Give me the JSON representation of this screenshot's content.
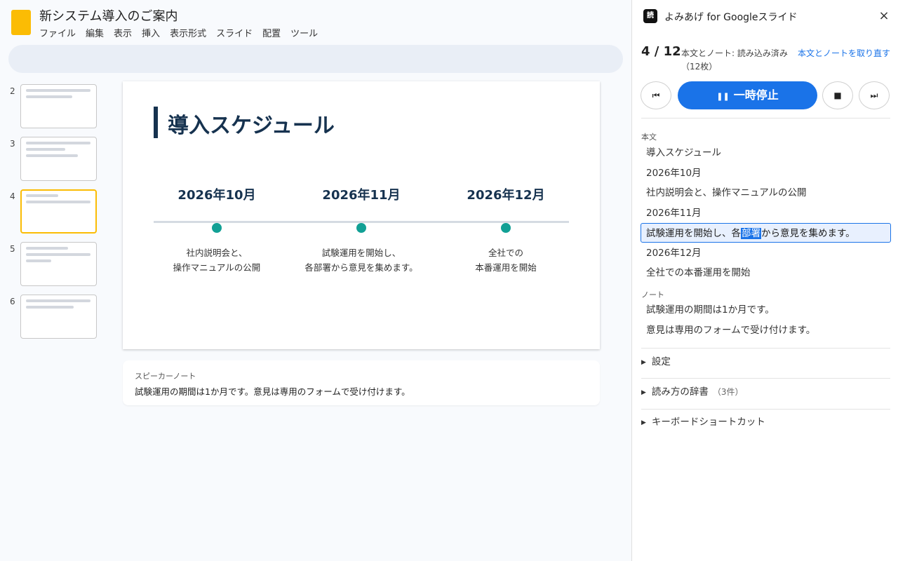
{
  "editor": {
    "doc_title": "新システム導入のご案内",
    "menu": [
      "ファイル",
      "編集",
      "表示",
      "挿入",
      "表示形式",
      "スライド",
      "配置",
      "ツール"
    ],
    "thumbnails": [
      {
        "number": "2",
        "selected": false
      },
      {
        "number": "3",
        "selected": false
      },
      {
        "number": "4",
        "selected": true
      },
      {
        "number": "5",
        "selected": false
      },
      {
        "number": "6",
        "selected": false
      }
    ],
    "slide": {
      "title": "導入スケジュール",
      "timeline": [
        {
          "date": "2026年10月",
          "line1": "社内説明会と、",
          "line2": "操作マニュアルの公開"
        },
        {
          "date": "2026年11月",
          "line1": "試験運用を開始し、",
          "line2": "各部署から意見を集めます。"
        },
        {
          "date": "2026年12月",
          "line1": "全社での",
          "line2": "本番運用を開始"
        }
      ]
    },
    "notes": {
      "label": "スピーカーノート",
      "text": "試験運用の期間は1か月です。意見は専用のフォームで受け付けます。"
    }
  },
  "panel": {
    "title": "よみあげ for Googleスライド",
    "logo_text": "読",
    "close_icon": "×",
    "counter": "4 / 12",
    "status_line1": "本文とノート: 読み込み済み",
    "status_line2": "（12枚）",
    "reload_link": "本文とノートを取り直す",
    "controls": {
      "prev_icon": "⏮",
      "pause_icon": "❚❚",
      "pause_label": "一時停止",
      "stop_icon": "■",
      "next_icon": "⏭"
    },
    "body_label": "本文",
    "body_segments": [
      "導入スケジュール",
      "2026年10月",
      "社内説明会と、操作マニュアルの公開",
      "2026年11月",
      "",
      "2026年12月",
      "全社での本番運用を開始"
    ],
    "active_segment": {
      "before": "試験運用を開始し、各",
      "highlight": "部署",
      "after": "から意見を集めます。"
    },
    "notes_label": "ノート",
    "note_segments": [
      "試験運用の期間は1か月です。",
      "意見は専用のフォームで受け付けます。"
    ],
    "sections": [
      {
        "label": "設定",
        "count": ""
      },
      {
        "label": "読み方の辞書",
        "count": "（3件）"
      },
      {
        "label": "キーボードショートカット",
        "count": ""
      }
    ],
    "accent_color": "#1a73e8"
  }
}
